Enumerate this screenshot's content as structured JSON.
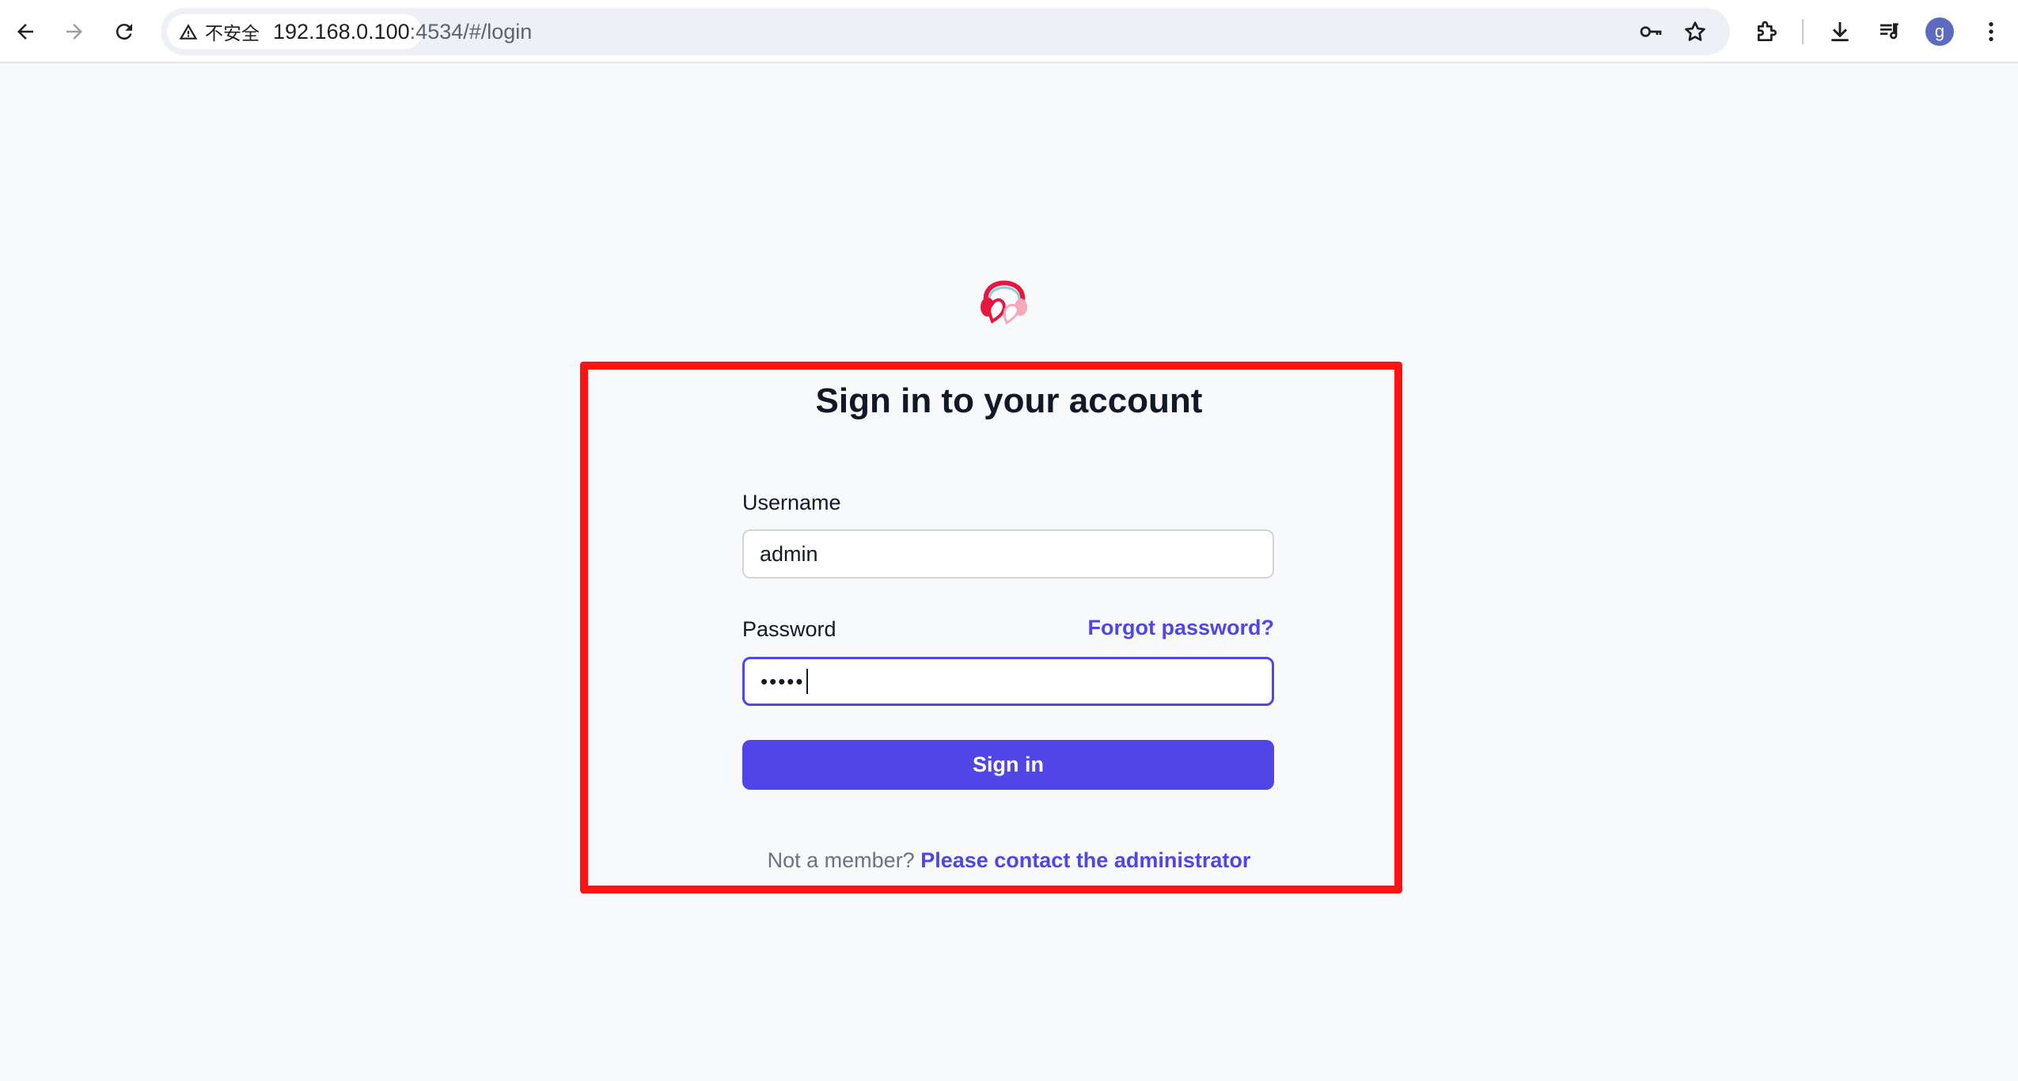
{
  "browser": {
    "security_label": "不安全",
    "url_host": "192.168.0.100",
    "url_rest": ":4534/#/login",
    "profile_initial": "g",
    "icons": {
      "back": "arrow-left-icon",
      "forward": "arrow-right-icon",
      "reload": "reload-icon",
      "warning": "warning-triangle-icon",
      "password": "key-icon",
      "bookmark": "star-icon",
      "extensions": "puzzle-icon",
      "downloads": "download-icon",
      "media": "queue-music-icon",
      "menu": "kebab-menu-icon"
    }
  },
  "login": {
    "logo": "headphones-heart-logo",
    "title": "Sign in to your account",
    "username_label": "Username",
    "username_value": "admin",
    "password_label": "Password",
    "password_masked": "•••••",
    "forgot_link": "Forgot password?",
    "submit_label": "Sign in",
    "footer_prefix": "Not a member?",
    "footer_link": "Please contact the administrator"
  },
  "colors": {
    "accent": "#4f46e5",
    "highlight": "#ff1212",
    "page_bg": "#f8f9fb",
    "text": "#111827",
    "muted": "#6b7280"
  }
}
